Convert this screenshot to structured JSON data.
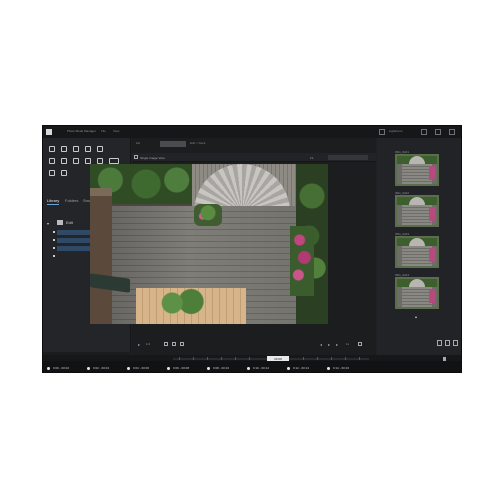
{
  "app": {
    "title": "Photo Mode Manager"
  },
  "menu": {
    "items": [
      "File",
      "View"
    ]
  },
  "window": {
    "minimize_label": "Lightroom"
  },
  "left_panel": {
    "tools": [
      "select-icon",
      "crop-icon",
      "heal-icon",
      "mask-icon",
      "brush-icon",
      "gradient-icon",
      "radial-icon",
      "eye-icon",
      "clone-icon",
      "levels-icon",
      "compare-icon",
      "grid-icon",
      "history-icon"
    ],
    "tabs": [
      "Library",
      "Folders",
      "Smart Album"
    ],
    "active_tab": 0,
    "tree": {
      "root_label": "Edit",
      "items": [
        "Deck overview",
        "Planter detail",
        "Fan trellis",
        "Garden wall"
      ]
    },
    "footer": {
      "status": "Sorted by capture",
      "count": "1 of 24"
    }
  },
  "center": {
    "path_prefix": "Lib",
    "path_suffix": "Edit > Deck",
    "view_label": "Single Image View",
    "zoom": "Fit",
    "transport": {
      "frame_label": "1/1",
      "speed": "1x"
    }
  },
  "right_panel": {
    "thumbnails": [
      {
        "label": "IMG_0241"
      },
      {
        "label": "IMG_0242"
      },
      {
        "label": "IMG_0243"
      },
      {
        "label": "IMG_0244"
      }
    ]
  },
  "timeline": {
    "badge": "00:08",
    "clips": [
      "0:00 - 00:02",
      "0:02 - 00:04",
      "0:04 - 00:06",
      "0:06 - 00:08",
      "0:08 - 00:10",
      "0:10 - 00:12",
      "0:12 - 00:14",
      "0:14 - 00:16"
    ]
  },
  "colors": {
    "accent": "#6aa2d9",
    "selection": "#2e4a67",
    "panel": "#242528",
    "marker": "#e2c86a"
  }
}
